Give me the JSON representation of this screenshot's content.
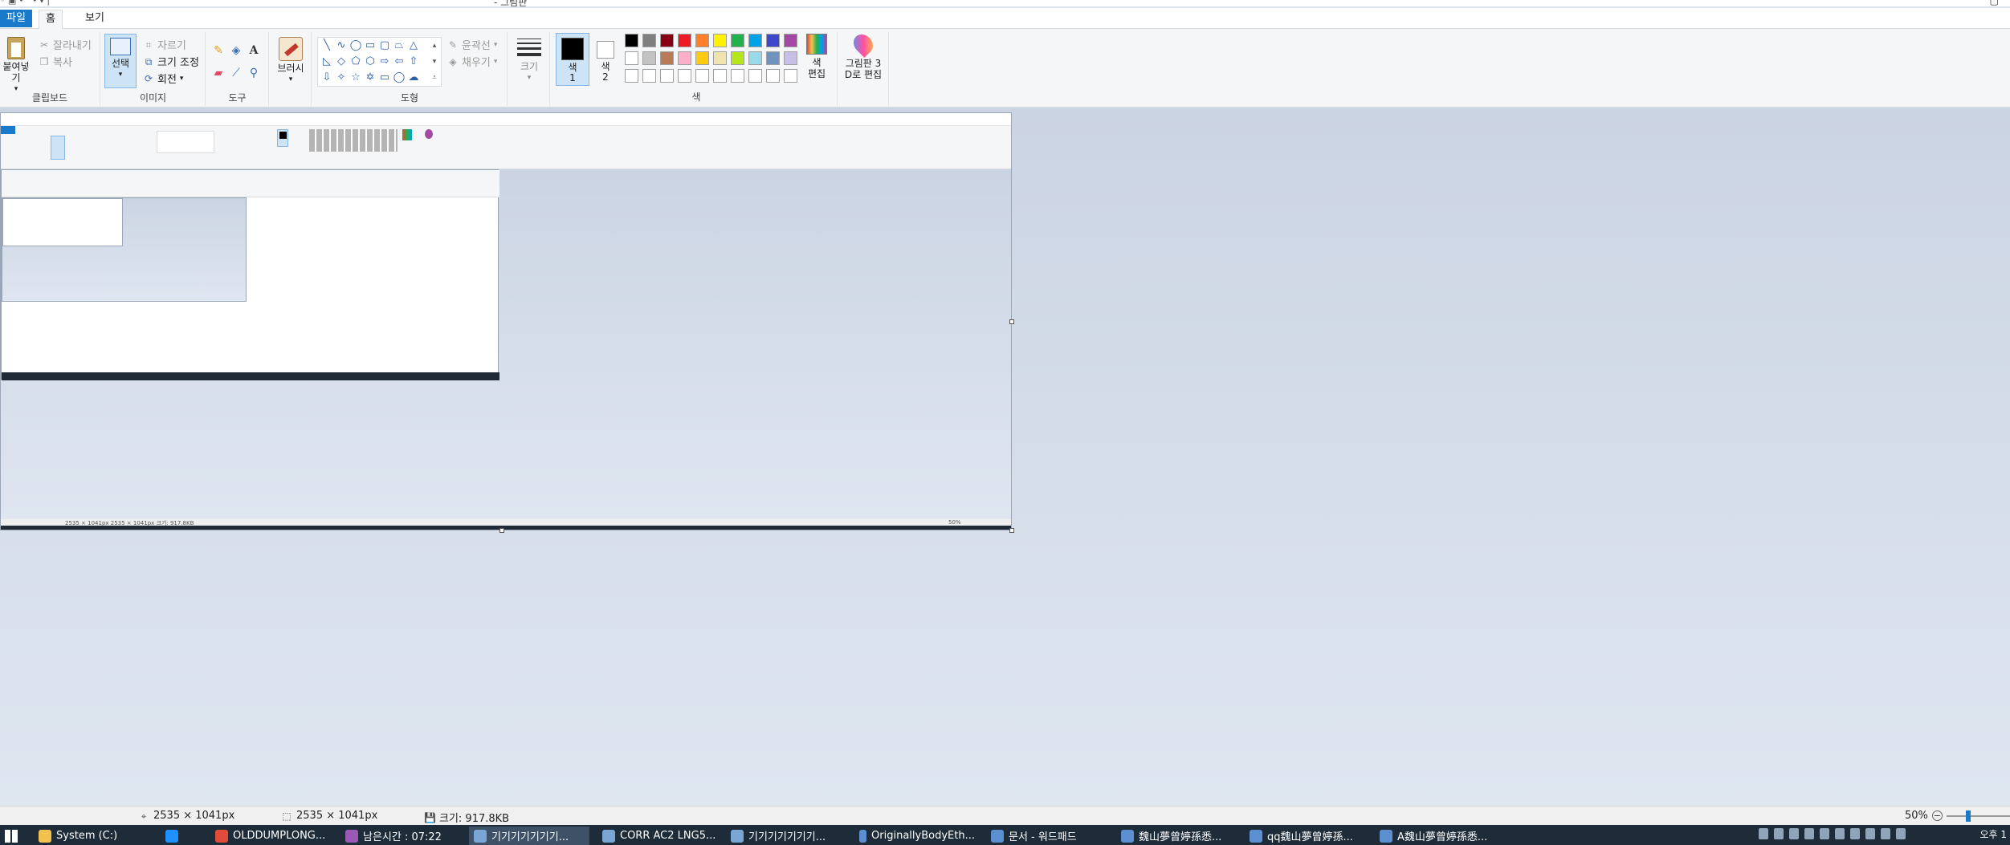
{
  "app": {
    "title": "- 그림판",
    "quick_access": "◦ ▣ ↶ ↷ ▾ |"
  },
  "tabs": [
    {
      "label": "파일"
    },
    {
      "label": "홈"
    },
    {
      "label": "보기"
    }
  ],
  "clipboard": {
    "paste": "붙여넣기",
    "cut": "잘라내기",
    "copy": "복사",
    "group": "클립보드"
  },
  "image": {
    "select": "선택",
    "crop": "자르기",
    "resize": "크기 조정",
    "rotate": "회전",
    "group": "이미지"
  },
  "tools": {
    "group": "도구"
  },
  "brushes": {
    "label": "브러시"
  },
  "shapes": {
    "outline": "윤곽선",
    "fill": "채우기",
    "group": "도형"
  },
  "size": {
    "label": "크기"
  },
  "colors": {
    "color1": "색\n1",
    "color2": "색\n2",
    "edit": "색\n편집",
    "group": "색",
    "palette_row1": [
      "#000000",
      "#7f7f7f",
      "#880015",
      "#ed1c24",
      "#ff7f27",
      "#fff200",
      "#22b14c",
      "#00a2e8",
      "#3f48cc",
      "#a349a4"
    ],
    "palette_row2": [
      "#ffffff",
      "#c3c3c3",
      "#b97a57",
      "#ffaec9",
      "#ffc90e",
      "#efe4b0",
      "#b5e61d",
      "#99d9ea",
      "#7092be",
      "#c8bfe7"
    ],
    "palette_row3": [
      "#ffffff",
      "#ffffff",
      "#ffffff",
      "#ffffff",
      "#ffffff",
      "#ffffff",
      "#ffffff",
      "#ffffff",
      "#ffffff",
      "#ffffff"
    ]
  },
  "paint3d": {
    "label": "그림판 3\nD로 편집"
  },
  "nested": {
    "status": "2535 × 1041px    2535 × 1041px    크기: 917.8KB",
    "zoom": "50%"
  },
  "status": {
    "cursor_pos": "2535 × 1041px",
    "selection_size": "2535 × 1041px",
    "file_size": "크기: 917.8KB",
    "zoom": "50%"
  },
  "taskbar": {
    "items": [
      {
        "label": "System (C:)",
        "color": "#f2c14e"
      },
      {
        "label": "",
        "color": "#1e90ff"
      },
      {
        "label": "OLDDUMPLONG...",
        "color": "#e04b3a"
      },
      {
        "label": "남은시간 : 07:22",
        "color": "#9b59b6"
      },
      {
        "label": "기기기기기기기...",
        "color": "#7aa6d6"
      },
      {
        "label": "CORR AC2 LNG5...",
        "color": "#7aa6d6"
      },
      {
        "label": "기기기기기기기...",
        "color": "#7aa6d6"
      },
      {
        "label": "OriginallyBodyEth...",
        "color": "#5b8fd0"
      },
      {
        "label": "문서 - 워드패드",
        "color": "#5b8fd0"
      },
      {
        "label": "魏山夢曾婷孫悉...",
        "color": "#5b8fd0"
      },
      {
        "label": "qq魏山夢曾婷孫...",
        "color": "#5b8fd0"
      },
      {
        "label": "A魏山夢曾婷孫悉...",
        "color": "#5b8fd0"
      }
    ],
    "clock": "오후 1"
  }
}
